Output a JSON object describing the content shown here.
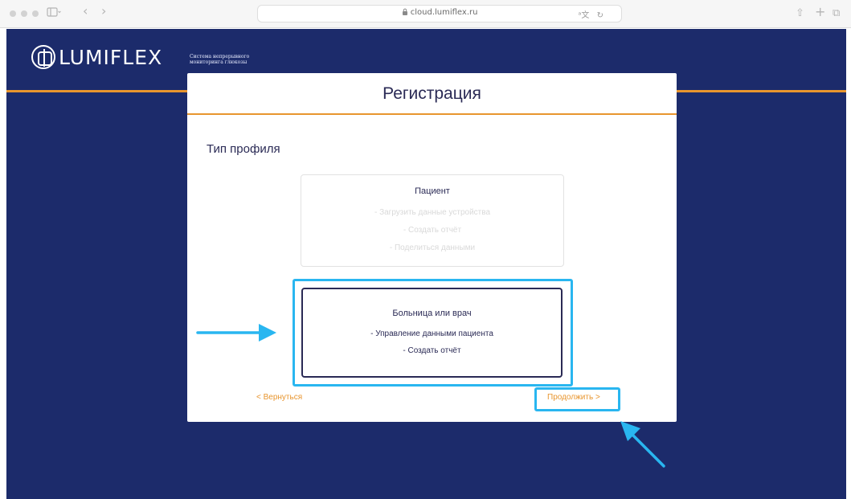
{
  "browser": {
    "url": "cloud.lumiflex.ru",
    "icons": [
      "sidebar-icon",
      "back-icon",
      "forward-icon",
      "lock-icon",
      "translate-icon",
      "reload-icon",
      "share-icon",
      "new-tab-icon",
      "tabs-icon"
    ],
    "back_glyph": "‹",
    "forward_glyph": "›",
    "translate_glyph": "ᵃ文",
    "reload_glyph": "↻",
    "share_glyph": "⇧",
    "new_tab_glyph": "+",
    "tabs_glyph": "⧉"
  },
  "header": {
    "logo_text": "LUMIFLEX",
    "tagline": "Система непрерывного мониторинга глюкозы"
  },
  "modal": {
    "title": "Регистрация",
    "section_title": "Тип профиля",
    "cards": [
      {
        "title": "Пациент",
        "features": [
          "- Загрузить данные устройства",
          "- Создать отчёт",
          "- Поделиться данными"
        ],
        "selected": false
      },
      {
        "title": "Больница или врач",
        "features": [
          "- Управление данными пациента",
          "- Создать отчёт"
        ],
        "selected": true
      }
    ],
    "back_label": "< Вернуться",
    "continue_label": "Продолжить >"
  },
  "colors": {
    "background": "#1c2b6b",
    "accent": "#e8952e",
    "highlight": "#29b6f0",
    "text": "#2a2a55"
  }
}
